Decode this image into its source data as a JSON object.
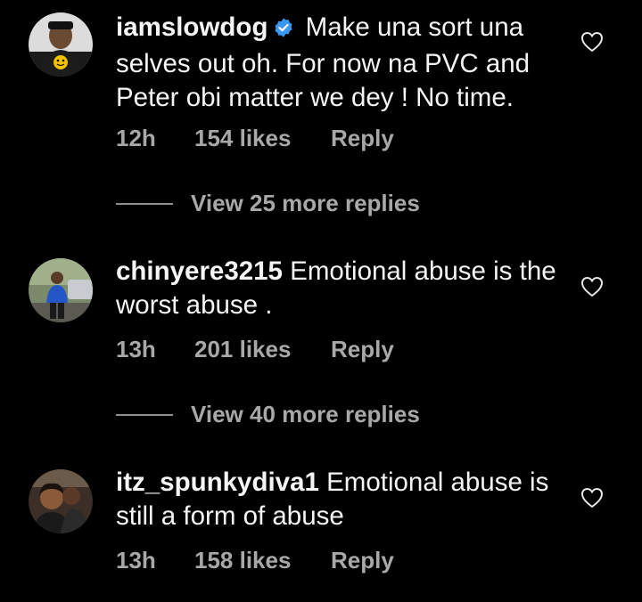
{
  "comments": [
    {
      "username": "iamslowdog",
      "verified": true,
      "text": "Make una sort una selves out oh. For now na PVC and Peter obi matter we dey ! No time.",
      "time": "12h",
      "likes": "154 likes",
      "reply": "Reply",
      "view_more": "View 25 more replies"
    },
    {
      "username": "chinyere3215",
      "verified": false,
      "text": "Emotional abuse is the worst abuse .",
      "time": "13h",
      "likes": "201 likes",
      "reply": "Reply",
      "view_more": "View 40 more replies"
    },
    {
      "username": "itz_spunkydiva1",
      "verified": false,
      "text": "Emotional abuse is still a form of abuse",
      "time": "13h",
      "likes": "158 likes",
      "reply": "Reply"
    }
  ],
  "colors": {
    "background": "#000000",
    "text": "#f5f5f5",
    "secondary_text": "#a8a8a8",
    "verified_badge": "#3897f0"
  },
  "icons": {
    "like": "heart-outline-icon",
    "verified": "verified-badge-icon"
  }
}
